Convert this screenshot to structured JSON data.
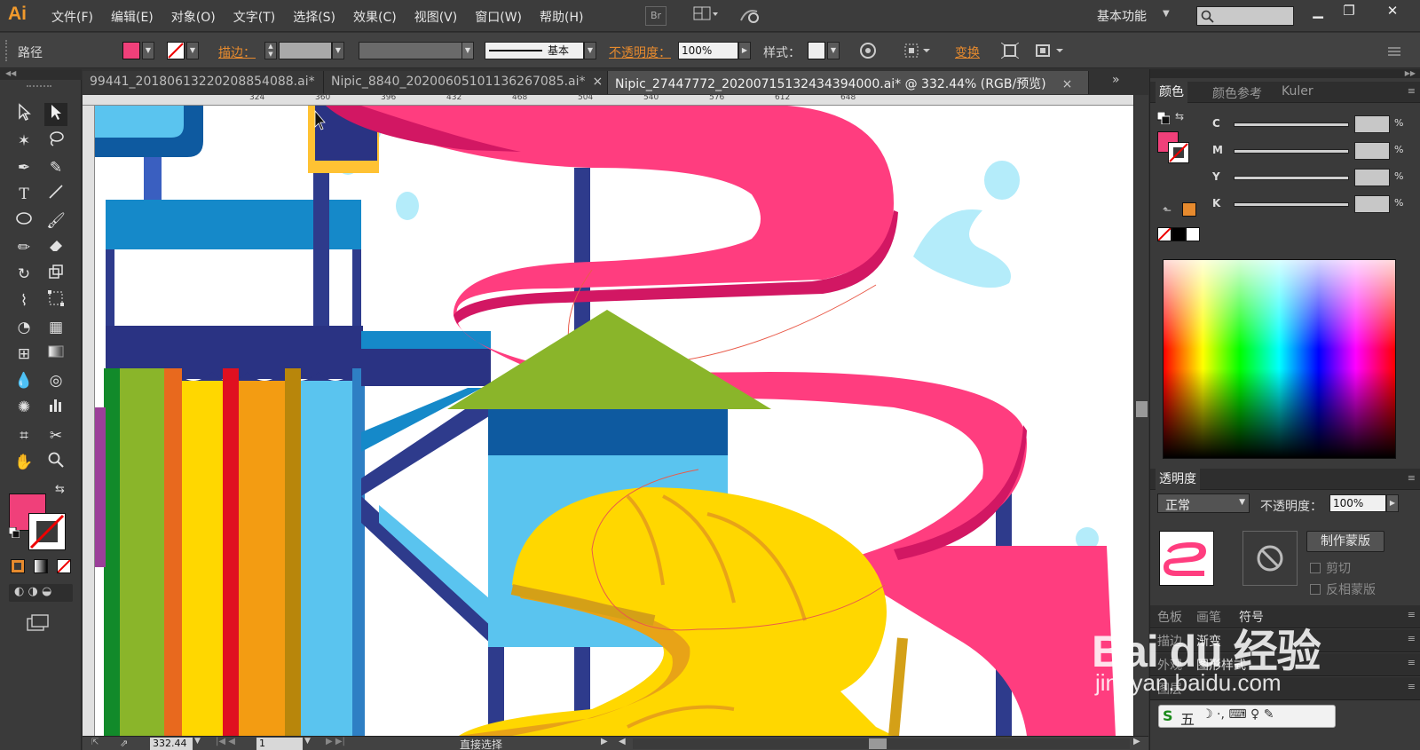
{
  "app": {
    "logo": "Ai",
    "menus": [
      "文件(F)",
      "编辑(E)",
      "对象(O)",
      "文字(T)",
      "选择(S)",
      "效果(C)",
      "视图(V)",
      "窗口(W)",
      "帮助(H)"
    ],
    "bridge_label": "Br",
    "workspace": "基本功能",
    "search_placeholder": ""
  },
  "control_bar": {
    "selection_label": "路径",
    "stroke_label": "描边：",
    "stroke_profile": "基本",
    "opacity_label": "不透明度：",
    "opacity_value": "100%",
    "style_label": "样式：",
    "transform_label": "变换"
  },
  "tabs": [
    {
      "label": "99441_20180613220208854088.ai*",
      "active": false
    },
    {
      "label": "Nipic_8840_20200605101136267085.ai*",
      "active": false
    },
    {
      "label": "Nipic_27447772_20200715132434394000.ai* @ 332.44% (RGB/预览)",
      "active": true
    }
  ],
  "ruler_ticks": [
    "324",
    "360",
    "396",
    "432",
    "468",
    "504",
    "540",
    "576",
    "612",
    "648"
  ],
  "status_bar": {
    "zoom": "332.44",
    "artboard": "1",
    "tool_status": "直接选择"
  },
  "color_panel": {
    "tabs": [
      "颜色",
      "颜色参考",
      "Kuler"
    ],
    "channels": [
      {
        "name": "C",
        "value": ""
      },
      {
        "name": "M",
        "value": ""
      },
      {
        "name": "Y",
        "value": ""
      },
      {
        "name": "K",
        "value": ""
      }
    ],
    "percent": "%"
  },
  "transparency_panel": {
    "title": "透明度",
    "blend_mode": "正常",
    "opacity_label": "不透明度：",
    "opacity_value": "100%",
    "make_mask": "制作蒙版",
    "clip_label": "剪切",
    "invert_label": "反相蒙版"
  },
  "collapsed_panels": [
    {
      "tabs": [
        "色板",
        "画笔",
        "符号"
      ]
    },
    {
      "tabs": [
        "描边",
        "渐变"
      ]
    },
    {
      "tabs": [
        "外观",
        "图形样式"
      ]
    },
    {
      "tabs": [
        "图层"
      ]
    }
  ],
  "watermark": {
    "brand": "Bai du 经验",
    "url": "jingyan.baidu.com"
  },
  "ime_label": "五",
  "colors": {
    "fill": "#f0407a",
    "accent_orange": "#e68a2e",
    "slide_pink": "#f0407a",
    "slide_yellow": "#ffd700",
    "roof_green": "#8ab52a",
    "tower_blue": "#0e5aa0"
  }
}
